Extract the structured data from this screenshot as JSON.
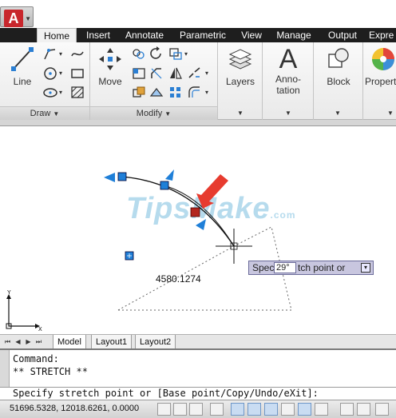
{
  "app": {
    "logo_letter": "A",
    "accent": "#c8262c"
  },
  "tabs": [
    "Home",
    "Insert",
    "Annotate",
    "Parametric",
    "View",
    "Manage",
    "Output",
    "Expre"
  ],
  "ribbon": {
    "draw": {
      "title": "Draw",
      "line_label": "Line"
    },
    "modify": {
      "title": "Modify",
      "move_label": "Move"
    },
    "layers": {
      "label": "Layers"
    },
    "annotation": {
      "label_1": "Anno-",
      "label_2": "tation"
    },
    "block": {
      "label": "Block"
    },
    "properties": {
      "label": "Propert"
    }
  },
  "canvas": {
    "watermark": "TipsMake",
    "watermark_suffix": ".com",
    "dimension_value": "4580.1274",
    "tooltip_prefix": "Speci",
    "tooltip_suffix": "tch point or",
    "tooltip_angle": "29°",
    "ucs_x": "X",
    "ucs_y": "Y"
  },
  "layout_tabs": [
    "Model",
    "Layout1",
    "Layout2"
  ],
  "command": {
    "line1": "Command:",
    "line2": "** STRETCH **",
    "prompt": "Specify stretch point or [Base point/Copy/Undo/eXit]:"
  },
  "status": {
    "coordinates": "51696.5328, 12018.6261, 0.0000"
  }
}
